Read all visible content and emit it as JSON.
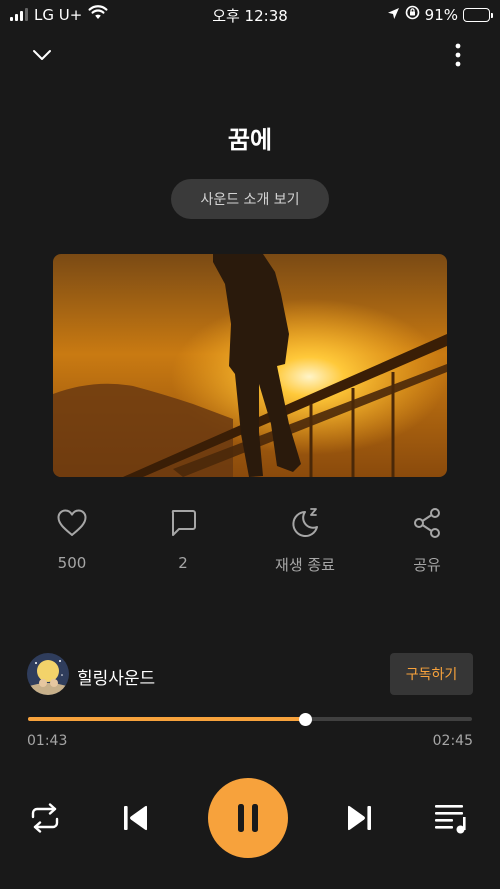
{
  "status_bar": {
    "carrier": "LG U+",
    "time": "오후 12:38",
    "battery": "91%",
    "battery_level": 0.91
  },
  "header": {
    "title": "꿈에",
    "intro_button_label": "사운드 소개 보기"
  },
  "actions": {
    "like_count": "500",
    "comment_count": "2",
    "sleep_timer_label": "재생 종료",
    "share_label": "공유"
  },
  "channel": {
    "name": "힐링사운드",
    "subscribe_label": "구독하기"
  },
  "playback": {
    "elapsed": "01:43",
    "duration": "02:45",
    "progress_fraction": 0.624,
    "state": "playing"
  },
  "colors": {
    "accent": "#f7a23c",
    "background": "#191919",
    "button_dark": "#3a3a3a",
    "secondary_text": "#a6a6a6"
  },
  "icons": [
    "chevron-down-icon",
    "more-vertical-icon",
    "heart-icon",
    "comment-icon",
    "moon-sleep-icon",
    "share-icon",
    "repeat-icon",
    "skip-previous-icon",
    "pause-icon",
    "skip-next-icon",
    "playlist-icon"
  ]
}
